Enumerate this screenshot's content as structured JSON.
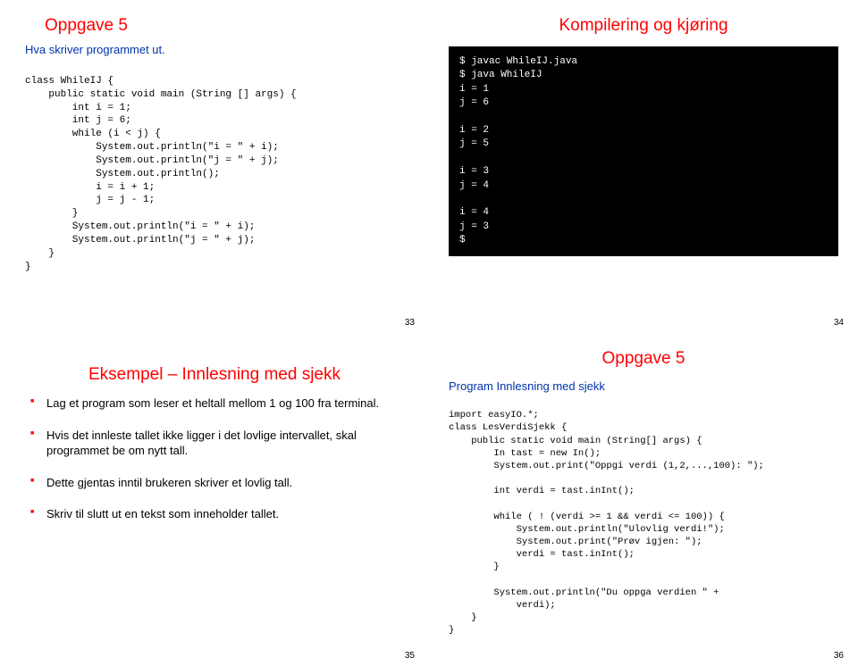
{
  "slide33": {
    "title": "Oppgave 5",
    "sub": "Hva skriver programmet ut.",
    "line1": "class WhileIJ {",
    "line2": "    public static void main (String [] args) {",
    "line3": "        int i = 1;",
    "line4": "        int j = 6;",
    "line5": "        while (i < j) {",
    "line6": "            System.out.println(\"i = \" + i);",
    "line7": "            System.out.println(\"j = \" + j);",
    "line8": "            System.out.println();",
    "line9": "            i = i + 1;",
    "line10": "            j = j - 1;",
    "line11": "        }",
    "line12": "        System.out.println(\"i = \" + i);",
    "line13": "        System.out.println(\"j = \" + j);",
    "line14": "    }",
    "line15": "}",
    "pagenum": "33"
  },
  "slide34": {
    "title": "Kompilering og kjøring",
    "term": "$ javac WhileIJ.java\n$ java WhileIJ\ni = 1\nj = 6\n\ni = 2\nj = 5\n\ni = 3\nj = 4\n\ni = 4\nj = 3\n$",
    "pagenum": "34"
  },
  "slide35": {
    "title": "Eksempel – Innlesning med sjekk",
    "b1": "Lag et program som leser et heltall mellom 1 og 100 fra terminal.",
    "b2": "Hvis det innleste tallet ikke ligger i det lovlige intervallet, skal programmet be om nytt tall.",
    "b3": "Dette gjentas inntil brukeren skriver et lovlig tall.",
    "b4": "Skriv til slutt ut en tekst som inneholder tallet.",
    "pagenum": "35"
  },
  "slide36": {
    "title": "Oppgave 5",
    "sub": "Program Innlesning med sjekk",
    "line1": "import easyIO.*;",
    "line2": "class LesVerdiSjekk {",
    "line3": "    public static void main (String[] args) {",
    "line4": "        In tast = new In();",
    "line5": "        System.out.print(\"Oppgi verdi (1,2,...,100): \");",
    "line6": "",
    "line7": "        int verdi = tast.inInt();",
    "line8": "",
    "line9": "        while ( ! (verdi >= 1 && verdi <= 100)) {",
    "line10": "            System.out.println(\"Ulovlig verdi!\");",
    "line11": "            System.out.print(\"Prøv igjen: \");",
    "line12": "            verdi = tast.inInt();",
    "line13": "        }",
    "line14": "",
    "line15": "        System.out.println(\"Du oppga verdien \" +",
    "line16": "            verdi);",
    "line17": "    }",
    "line18": "}",
    "pagenum": "36"
  }
}
